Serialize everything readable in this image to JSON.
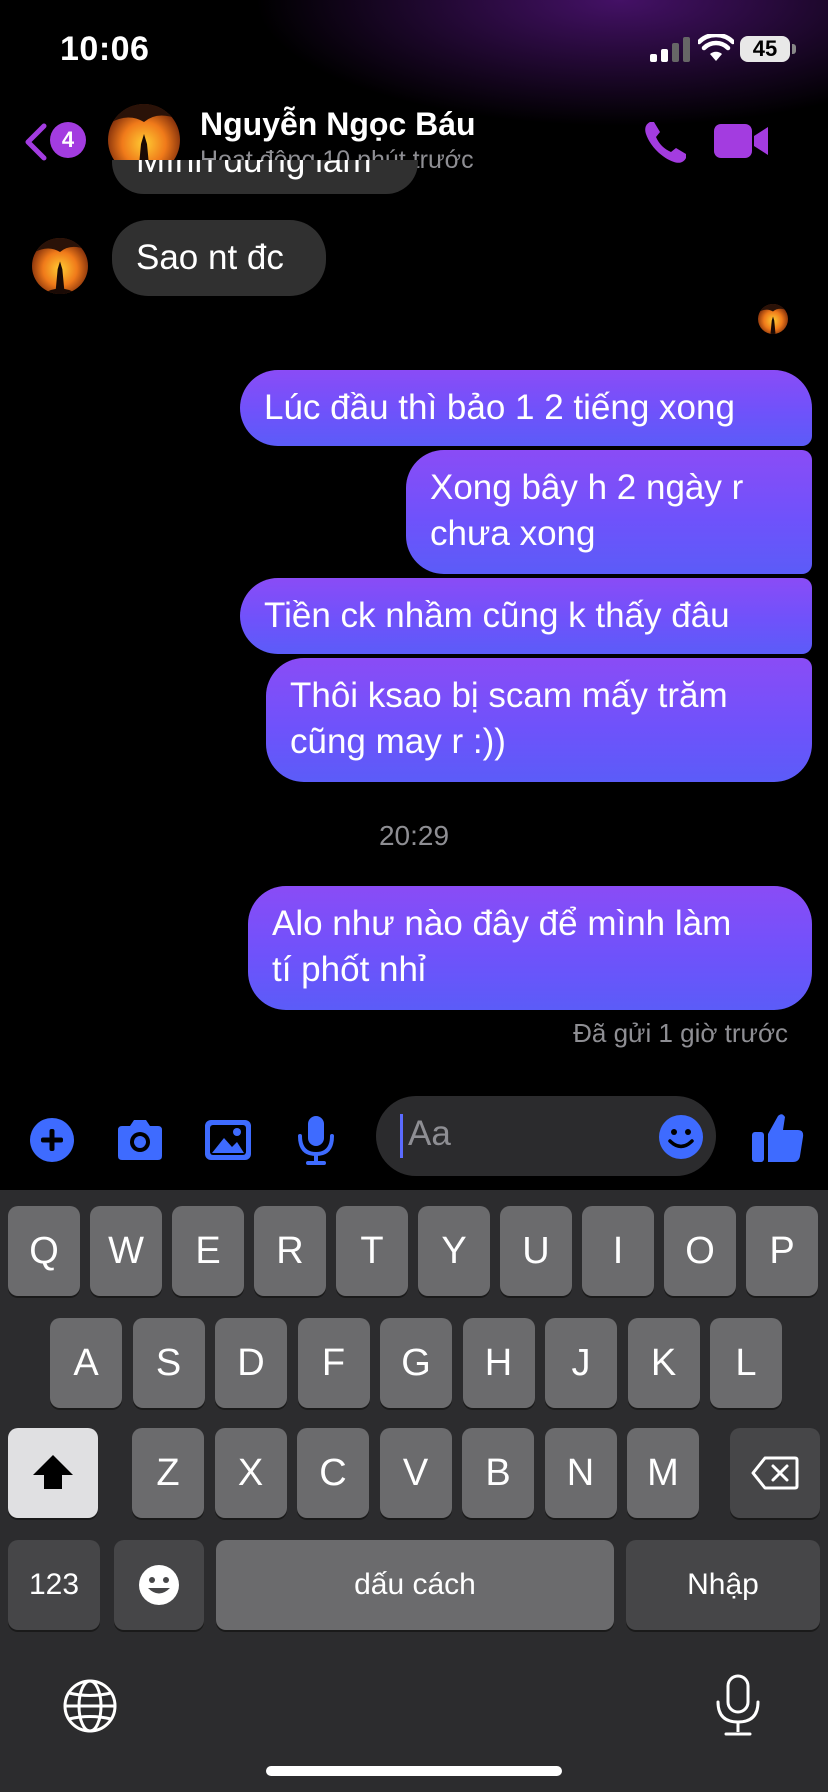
{
  "status_bar": {
    "time": "10:06",
    "battery": "45"
  },
  "header": {
    "back_badge": "4",
    "contact_name": "Nguyễn Ngọc Báu",
    "activity": "Hoạt động 10 phút trước"
  },
  "messages": {
    "partial_top": "Mình đừng làm",
    "incoming_1": "Sao nt đc",
    "outgoing_1": "Lúc đầu thì bảo 1 2 tiếng xong",
    "outgoing_2_line1": "Xong bây h 2 ngày r",
    "outgoing_2_line2": "chưa xong",
    "outgoing_3": "Tiền ck nhầm cũng k thấy đâu",
    "outgoing_4_line1": "Thôi ksao bị scam mấy trăm",
    "outgoing_4_line2": "cũng may r :))",
    "time_separator": "20:29",
    "outgoing_5_line1": "Alo như nào đây để mình làm",
    "outgoing_5_line2": "tí phốt nhỉ",
    "sent_status": "Đã gửi 1 giờ trước"
  },
  "composer": {
    "placeholder": "Aa"
  },
  "keyboard": {
    "row1": [
      "Q",
      "W",
      "E",
      "R",
      "T",
      "Y",
      "U",
      "I",
      "O",
      "P"
    ],
    "row2": [
      "A",
      "S",
      "D",
      "F",
      "G",
      "H",
      "J",
      "K",
      "L"
    ],
    "row3": [
      "Z",
      "X",
      "C",
      "V",
      "B",
      "N",
      "M"
    ],
    "numbers_key": "123",
    "space_key": "dấu cách",
    "return_key": "Nhập"
  },
  "colors": {
    "accent_purple": "#a33ce0",
    "bubble_out_top": "#8a4cf6",
    "bubble_out_bottom": "#5b5cf8",
    "composer_icon_blue": "#3e6bff"
  }
}
